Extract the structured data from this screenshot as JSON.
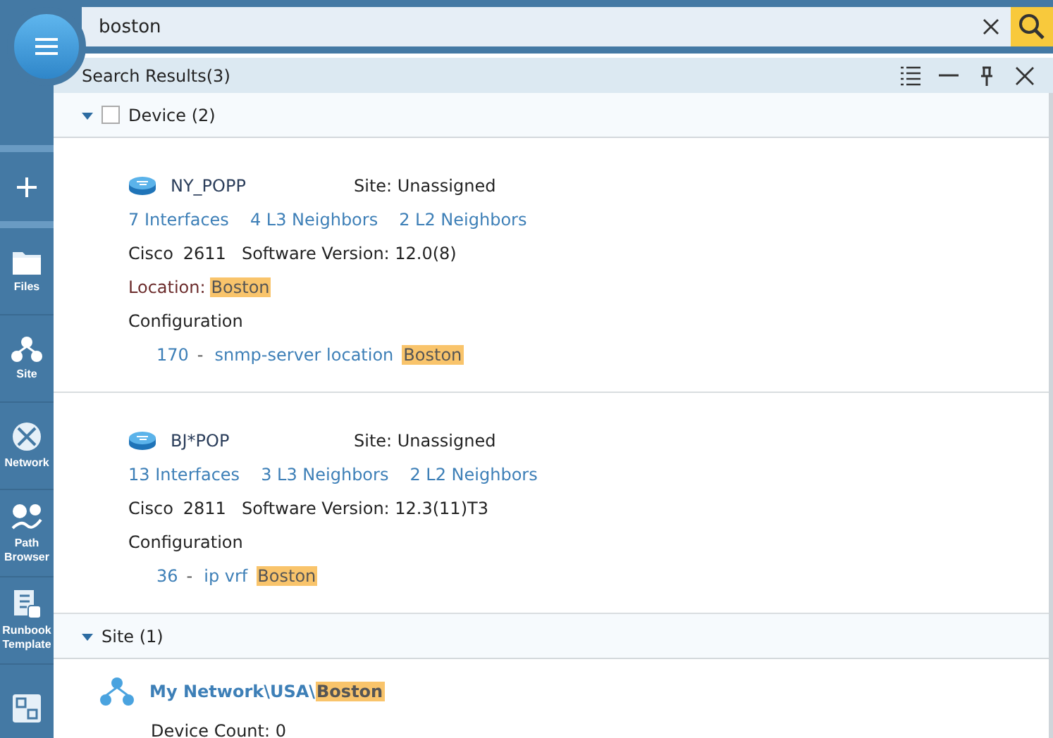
{
  "search": {
    "value": "boston"
  },
  "sidebar": {
    "items": [
      {
        "kind": "add"
      },
      {
        "kind": "files",
        "label": "Files"
      },
      {
        "kind": "site",
        "label": "Site"
      },
      {
        "kind": "network",
        "label": "Network"
      },
      {
        "kind": "path",
        "label": "Path Browser"
      },
      {
        "kind": "runbook",
        "label": "Runbook Template"
      },
      {
        "kind": "other"
      }
    ]
  },
  "panel": {
    "title": "Search Results(3)"
  },
  "groups": [
    {
      "kind": "device",
      "title": "Device (2)",
      "expanded": true,
      "checked": false,
      "devices": [
        {
          "name": "NY_POPP",
          "site": "Site: Unassigned",
          "links": [
            "7 Interfaces",
            "4 L3 Neighbors",
            "2 L2 Neighbors"
          ],
          "vendor": "Cisco",
          "model": "2611",
          "version": "Software Version: 12.0(8)",
          "location": {
            "label": "Location:",
            "match": "Boston"
          },
          "config_title": "Configuration",
          "config": [
            {
              "line": "170",
              "dash": "-",
              "text": "snmp-server location",
              "match": "Boston"
            }
          ]
        },
        {
          "name": "BJ*POP",
          "site": "Site: Unassigned",
          "links": [
            "13 Interfaces",
            "3 L3 Neighbors",
            "2 L2 Neighbors"
          ],
          "vendor": "Cisco",
          "model": "2811",
          "version": "Software Version: 12.3(11)T3",
          "config_title": "Configuration",
          "config": [
            {
              "line": "36",
              "dash": "-",
              "text": "ip vrf",
              "match": "Boston"
            }
          ]
        }
      ]
    },
    {
      "kind": "site",
      "title": "Site (1)",
      "expanded": true,
      "sites": [
        {
          "path": "My Network\\USA\\",
          "match": "Boston",
          "count": "Device Count: 0"
        }
      ]
    }
  ]
}
